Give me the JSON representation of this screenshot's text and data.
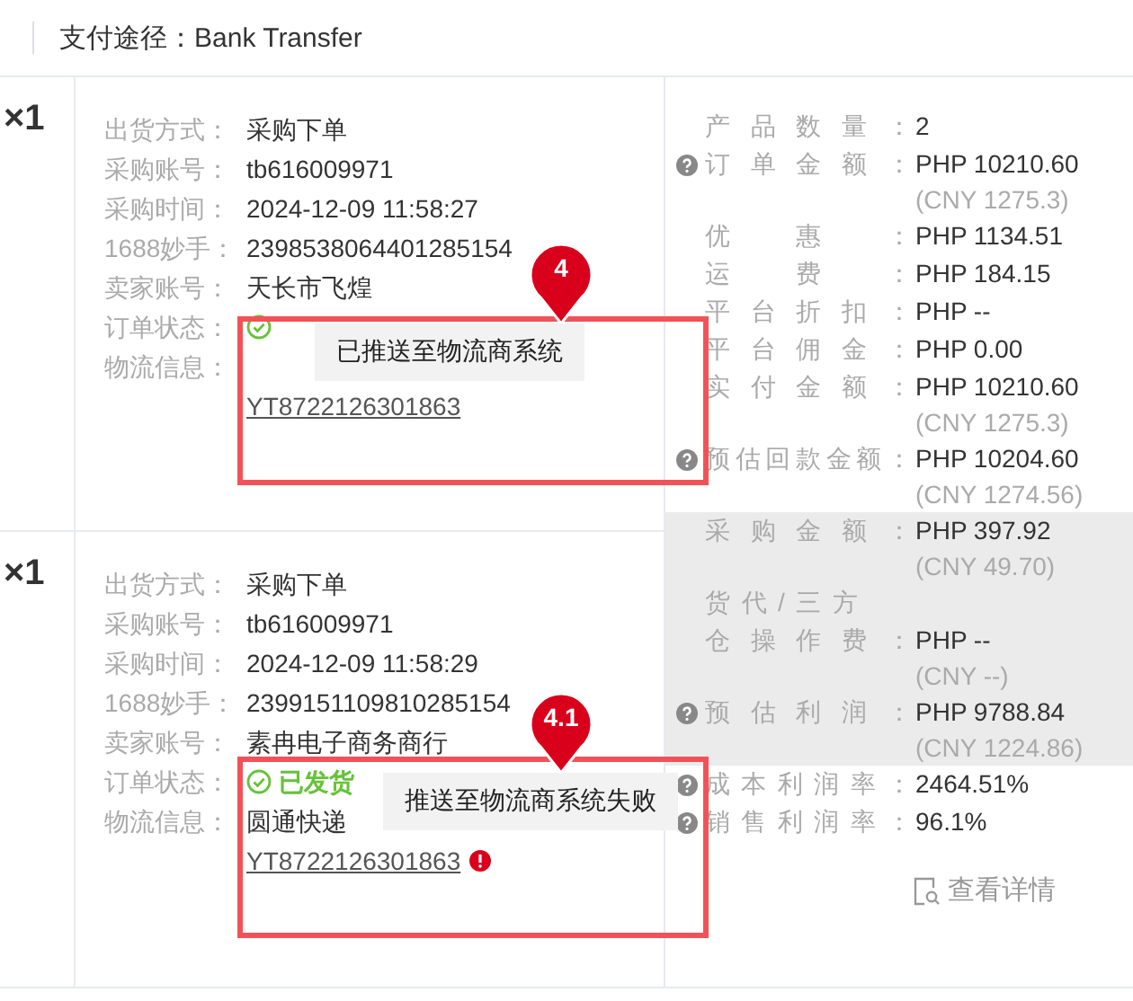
{
  "top_bar": {
    "payment": "支付途径：Bank Transfer"
  },
  "orders": [
    {
      "quantity": "×1",
      "fields": [
        {
          "kind": "text",
          "label": "出货方式：",
          "value": "采购下单"
        },
        {
          "kind": "text",
          "label": "采购账号：",
          "value": "tb616009971"
        },
        {
          "kind": "text",
          "label": "采购时间：",
          "value": "2024-12-09 11:58:27"
        },
        {
          "kind": "text",
          "label": "1688妙手：",
          "value": "2398538064401285154"
        },
        {
          "kind": "text",
          "label": "卖家账号：",
          "value": "天长市飞煌"
        },
        {
          "kind": "status",
          "label": "订单状态："
        },
        {
          "kind": "logistics",
          "label": "物流信息：",
          "tracking": "YT8722126301863",
          "error": false
        }
      ]
    },
    {
      "quantity": "×1",
      "fields": [
        {
          "kind": "text",
          "label": "出货方式：",
          "value": "采购下单"
        },
        {
          "kind": "text",
          "label": "采购账号：",
          "value": "tb616009971"
        },
        {
          "kind": "text",
          "label": "采购时间：",
          "value": "2024-12-09 11:58:29"
        },
        {
          "kind": "text",
          "label": "1688妙手：",
          "value": "2399151109810285154"
        },
        {
          "kind": "text",
          "label": "卖家账号：",
          "value": "素冉电子商务商行"
        },
        {
          "kind": "status",
          "label": "订单状态：",
          "value": "已发货"
        },
        {
          "kind": "logistics",
          "label": "物流信息：",
          "carrier": "圆通快递",
          "tracking": "YT8722126301863",
          "error": true
        }
      ]
    }
  ],
  "summary": [
    {
      "shaded": false,
      "rows": [
        {
          "label": "产品数量：",
          "value": "2",
          "help": false
        },
        {
          "label": "订单金额：",
          "value": "PHP 10210.60",
          "sub": "(CNY 1275.3)",
          "help": true
        },
        {
          "label": "优惠：",
          "value": "PHP 1134.51",
          "help": false
        },
        {
          "label": "运费：",
          "value": "PHP 184.15",
          "help": false
        },
        {
          "label": "平台折扣：",
          "value": "PHP --",
          "help": false
        },
        {
          "label": "平台佣金：",
          "value": "PHP 0.00",
          "help": false
        },
        {
          "label": "实付金额：",
          "value": "PHP 10210.60",
          "sub": "(CNY 1275.3)",
          "help": false
        },
        {
          "label": "预估回款金额：",
          "value": "PHP 10204.60",
          "sub": "(CNY 1274.56)",
          "help": true
        }
      ]
    },
    {
      "shaded": true,
      "rows": [
        {
          "label": "采购金额：",
          "value": "PHP 397.92",
          "sub": "(CNY 49.70)",
          "help": false
        },
        {
          "label_top": "货代/三方",
          "label": "仓操作费：",
          "value": "PHP --",
          "sub": "(CNY --)",
          "help": false
        },
        {
          "label": "预估利润：",
          "value": "PHP 9788.84",
          "sub": "(CNY 1224.86)",
          "help": true
        }
      ]
    },
    {
      "shaded": false,
      "rows": [
        {
          "label": "成本利润率：",
          "value": "2464.51%",
          "help": true
        },
        {
          "label": "销售利润率：",
          "value": "96.1%",
          "help": true
        }
      ]
    }
  ],
  "details_link": "查看详情",
  "annotations": [
    {
      "number": "4",
      "tooltip": "已推送至物流商系统"
    },
    {
      "number": "4.1",
      "tooltip": "推送至物流商系统失败"
    }
  ]
}
